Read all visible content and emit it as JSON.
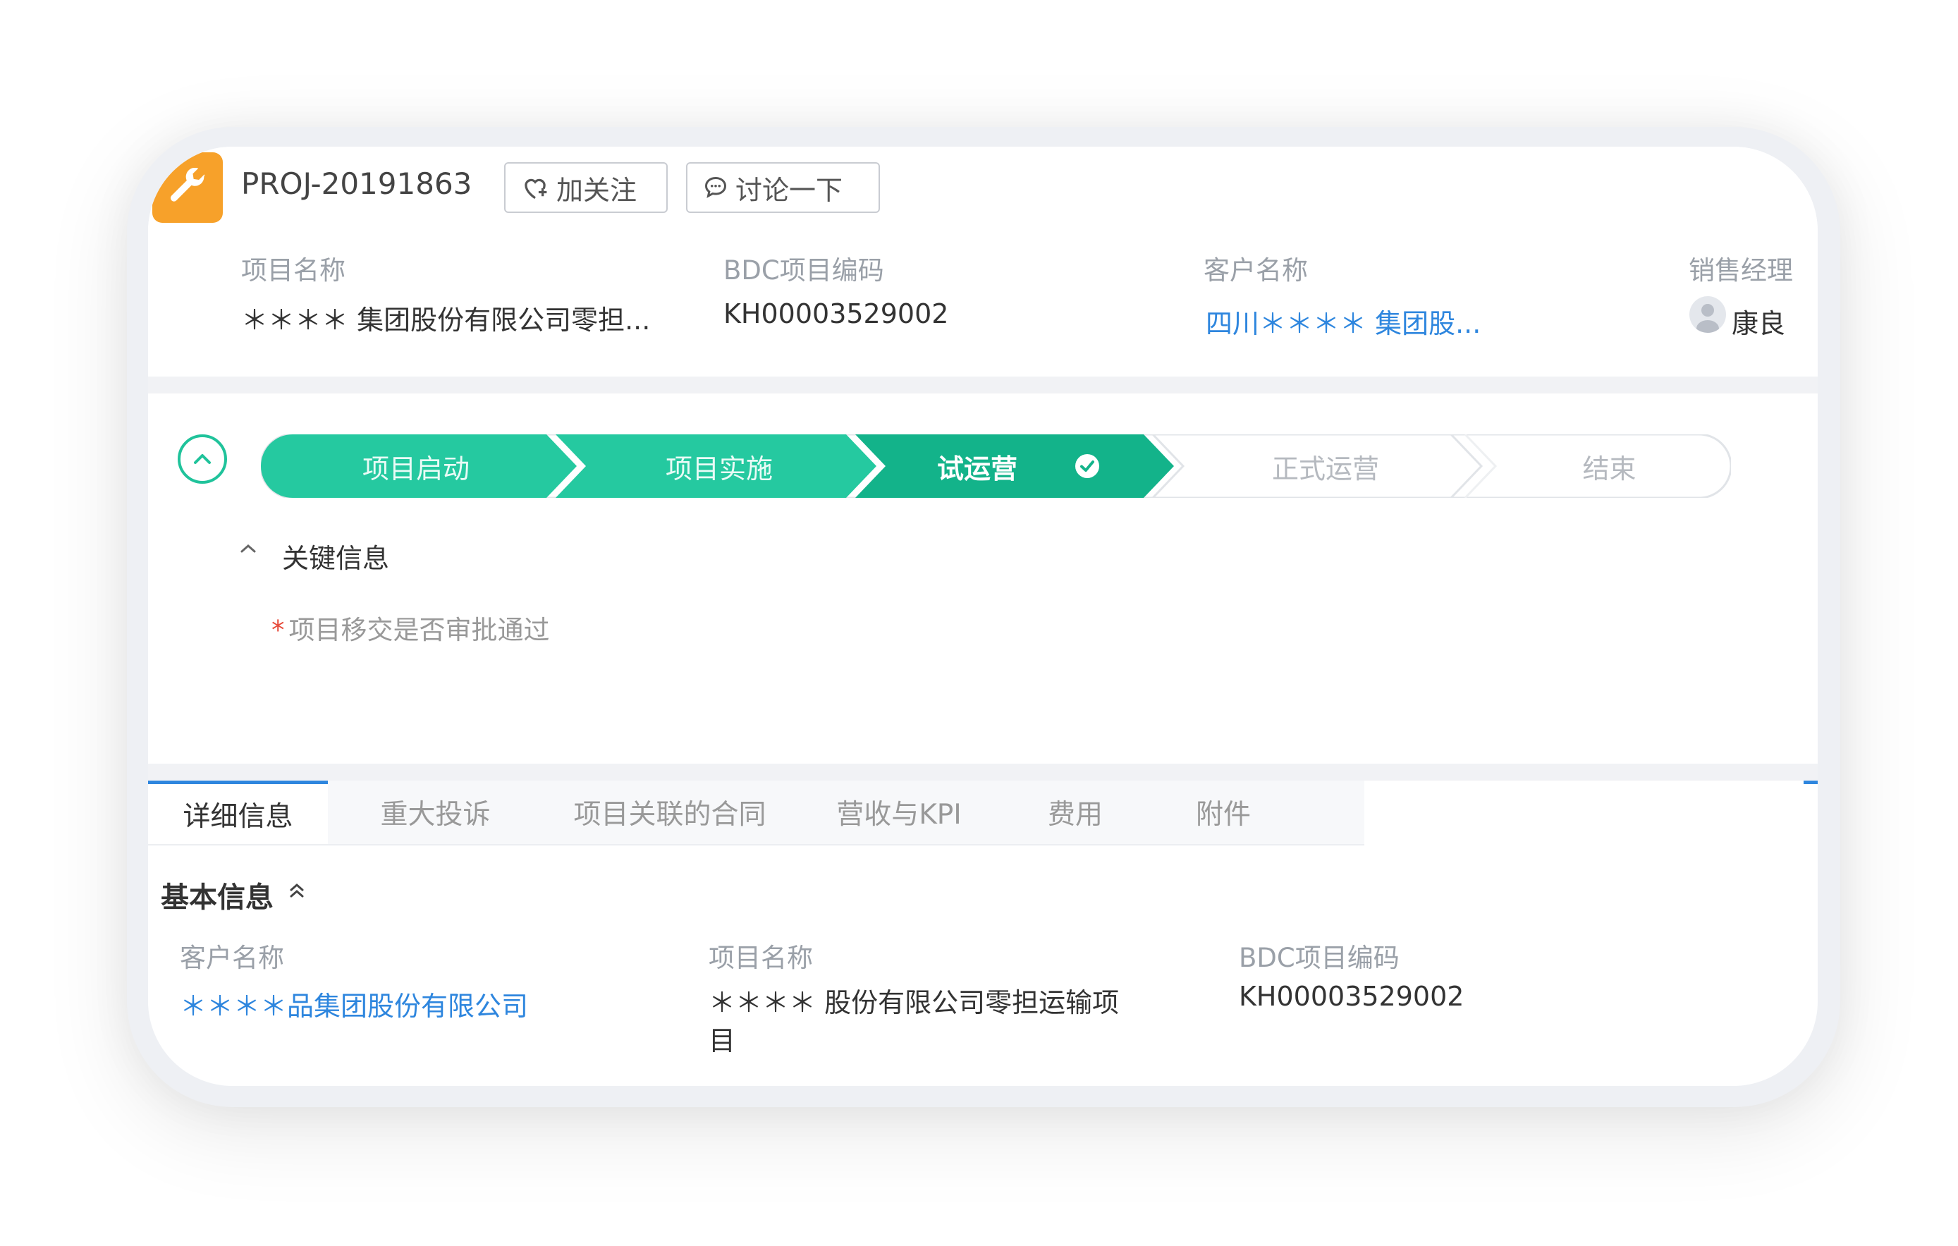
{
  "header": {
    "project_id": "PROJ-20191863",
    "follow_label": "加关注",
    "discuss_label": "讨论一下",
    "fields": [
      {
        "label": "项目名称",
        "value": "＊＊＊＊ 集团股份有限公司零担..."
      },
      {
        "label": "BDC项目编码",
        "value": "KH00003529002"
      },
      {
        "label": "客户名称",
        "value": "四川＊＊＊＊ 集团股..."
      },
      {
        "label": "销售经理",
        "value": "康良"
      }
    ]
  },
  "stages": [
    {
      "label": "项目启动",
      "status": "done"
    },
    {
      "label": "项目实施",
      "status": "done"
    },
    {
      "label": "试运营",
      "status": "current"
    },
    {
      "label": "正式运营",
      "status": "todo"
    },
    {
      "label": "结束",
      "status": "todo"
    }
  ],
  "key_info": {
    "title": "关键信息",
    "fields": [
      {
        "label": "项目移交是否审批通过",
        "required": true
      }
    ]
  },
  "tabs": [
    {
      "label": "详细信息",
      "active": true
    },
    {
      "label": "重大投诉",
      "active": false
    },
    {
      "label": "项目关联的合同",
      "active": false
    },
    {
      "label": "营收与KPI",
      "active": false
    },
    {
      "label": "费用",
      "active": false
    },
    {
      "label": "附件",
      "active": false
    }
  ],
  "basic_info": {
    "title": "基本信息",
    "fields": [
      {
        "label": "客户名称",
        "value": "＊＊＊＊品集团股份有限公司"
      },
      {
        "label": "项目名称",
        "value": "＊＊＊＊ 股份有限公司零担运输项",
        "value_line2": "目"
      },
      {
        "label": "BDC项目编码",
        "value": "KH00003529002"
      }
    ]
  },
  "colors": {
    "accent_green": "#25c9a0",
    "current_green": "#13b38a",
    "link_blue": "#2e86de",
    "icon_orange": "#f7a12a"
  }
}
